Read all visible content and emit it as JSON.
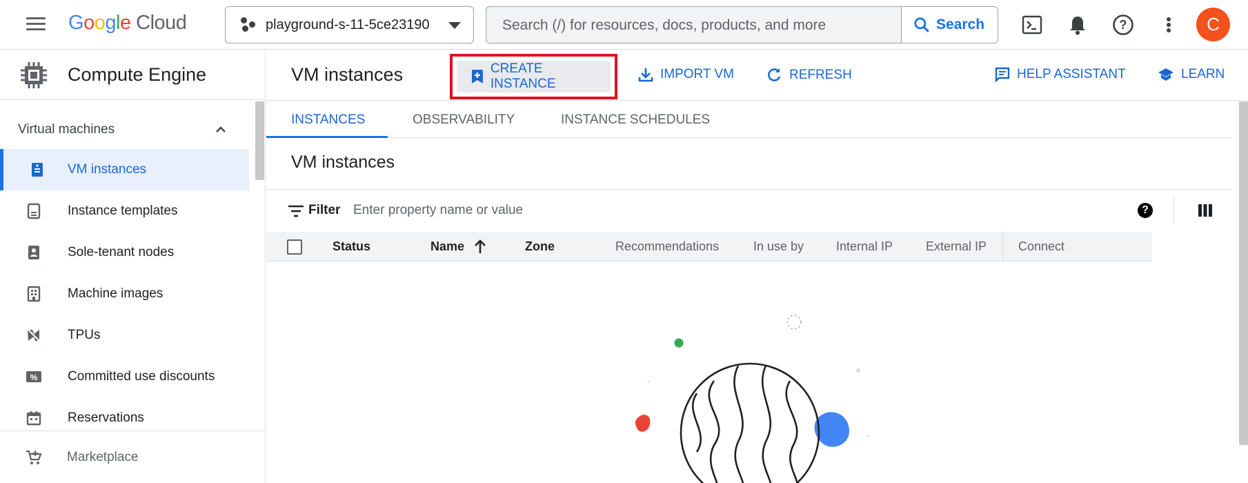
{
  "topbar": {
    "logo": {
      "letters": [
        "G",
        "o",
        "o",
        "g",
        "l",
        "e"
      ],
      "product": "Cloud"
    },
    "project": "playground-s-11-5ce23190",
    "search": {
      "placeholder": "Search (/) for resources, docs, products, and more",
      "button": "Search"
    },
    "icons": [
      "menu-icon",
      "terminal-icon",
      "bell-icon",
      "help-icon",
      "more-vert-icon"
    ],
    "avatar_initial": "C",
    "avatar_color": "#f4511e"
  },
  "sidebar": {
    "product": "Compute Engine",
    "section": "Virtual machines",
    "items": [
      {
        "label": "VM instances",
        "icon": "vm-instance-icon",
        "active": true
      },
      {
        "label": "Instance templates",
        "icon": "template-icon"
      },
      {
        "label": "Sole-tenant nodes",
        "icon": "sole-tenant-icon"
      },
      {
        "label": "Machine images",
        "icon": "machine-image-icon"
      },
      {
        "label": "TPUs",
        "icon": "tpu-icon"
      },
      {
        "label": "Committed use discounts",
        "icon": "discount-icon"
      },
      {
        "label": "Reservations",
        "icon": "calendar-icon"
      }
    ],
    "footer": {
      "label": "Marketplace",
      "icon": "cart-icon"
    }
  },
  "main": {
    "page_title": "VM instances",
    "actions": {
      "create": "CREATE INSTANCE",
      "import": "IMPORT VM",
      "refresh": "REFRESH",
      "help_assistant": "HELP ASSISTANT",
      "learn": "LEARN"
    },
    "tabs": [
      {
        "label": "INSTANCES",
        "active": true
      },
      {
        "label": "OBSERVABILITY"
      },
      {
        "label": "INSTANCE SCHEDULES"
      }
    ],
    "section_title": "VM instances",
    "filter": {
      "label": "Filter",
      "placeholder": "Enter property name or value",
      "help": "?"
    },
    "table": {
      "columns": [
        "Status",
        "Name",
        "Zone",
        "Recommendations",
        "In use by",
        "Internal IP",
        "External IP",
        "Connect"
      ],
      "sort_column": "Name",
      "sort_direction": "ascending",
      "rows": []
    }
  },
  "colors": {
    "accent": "#1a73e8",
    "highlight_box": "#e3101b",
    "active_bg": "#e8f0fe"
  }
}
